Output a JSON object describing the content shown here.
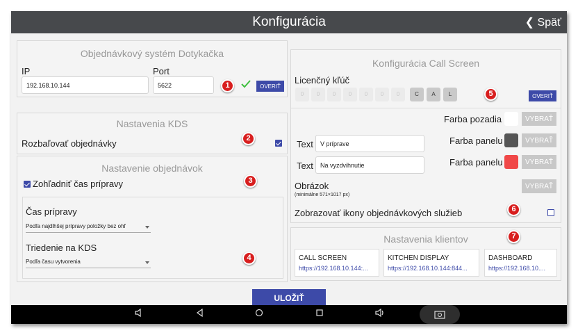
{
  "header": {
    "title": "Konfigurácia",
    "back_label": "Späť"
  },
  "ordering": {
    "title": "Objednávkový systém Dotykačka",
    "ip_label": "IP",
    "ip_value": "192.168.10.144",
    "port_label": "Port",
    "port_value": "5622",
    "verify_label": "OVERIŤ"
  },
  "kds": {
    "title": "Nastavenia KDS",
    "expand_label": "Rozbaľovať objednávky",
    "expand_checked": true
  },
  "orders": {
    "title": "Nastavenie objednávok",
    "prep_time_checkbox": "Zohľadniť čas prípravy",
    "prep_time_label": "Čas prípravy",
    "prep_time_value": "Podľa najdlhšej prípravy položky bez ohľ",
    "sort_label": "Triedenie na KDS",
    "sort_value": "Podľa času vytvorenia"
  },
  "callscreen": {
    "title": "Konfigurácia Call Screen",
    "license_label": "Licenčný kľúč",
    "license_keys": [
      "0",
      "0",
      "0",
      "0",
      "0",
      "0",
      "0",
      "C",
      "A",
      "L"
    ],
    "verify_label": "OVERIŤ",
    "bg_color_label": "Farba pozadia",
    "panel_color_label_1": "Farba panelu",
    "panel_color_label_2": "Farba panelu",
    "pick_label": "VYBRAŤ",
    "text_label_1": "Text",
    "text_value_1": "V príprave",
    "text_label_2": "Text",
    "text_value_2": "Na vyzdvihnutie",
    "image_label": "Obrázok",
    "image_hint": "(minimálne 571×1017 px)",
    "show_icons_label": "Zobrazovať ikony objednávkových služieb",
    "show_icons_checked": false,
    "colors": {
      "background": "#ffffff",
      "panel_1": "#555555",
      "panel_2": "#f04848"
    }
  },
  "clients": {
    "title": "Nastavenia klientov",
    "items": [
      {
        "name": "CALL SCREEN",
        "url": "https://192.168.10.144:..."
      },
      {
        "name": "KITCHEN DISPLAY",
        "url": "https://192.168.10.144:844..."
      },
      {
        "name": "DASHBOARD",
        "url": "https://192.168.10...."
      }
    ]
  },
  "save_label": "ULOŽIŤ",
  "badges": [
    "1",
    "2",
    "3",
    "4",
    "5",
    "6",
    "7"
  ],
  "accent_color": "#3d4aa8",
  "android_nav": [
    "volume-down-icon",
    "back-icon",
    "home-icon",
    "recents-icon",
    "volume-up-icon",
    "screenshot-icon"
  ]
}
